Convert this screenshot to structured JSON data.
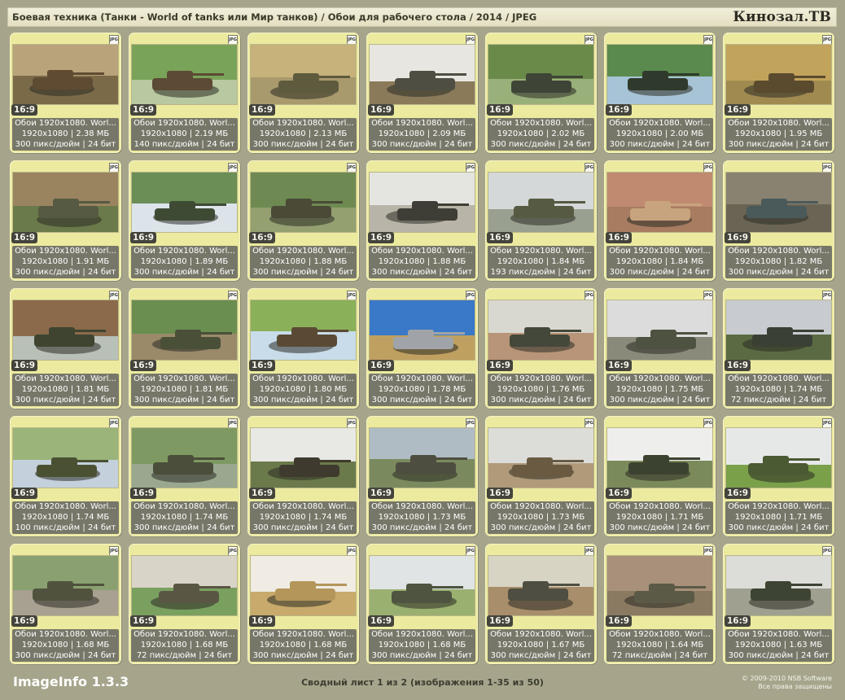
{
  "header": {
    "title": "Боевая техника (Танки - World of tanks или Мир танков) / Обои для рабочего стола / 2014 / JPEG",
    "brand": "Кинозал.ТВ"
  },
  "file_type_icon": "JPG",
  "aspect_label": "16:9",
  "thumbnails": [
    {
      "name": "Обои 1920x1080. Worl...",
      "dims": "1920x1080",
      "size": "2.38 МБ",
      "dpi": "300 пикс/дюйм",
      "bits": "24 бит",
      "colors": [
        "#b9a37a",
        "#5f4a32",
        "#7a6a48"
      ]
    },
    {
      "name": "Обои 1920x1080. Worl...",
      "dims": "1920x1080",
      "size": "2.19 МБ",
      "dpi": "140 пикс/дюйм",
      "bits": "24 бит",
      "colors": [
        "#7aa35a",
        "#5c4a34",
        "#b8c8a0"
      ]
    },
    {
      "name": "Обои 1920x1080. Worl...",
      "dims": "1920x1080",
      "size": "2.13 МБ",
      "dpi": "300 пикс/дюйм",
      "bits": "24 бит",
      "colors": [
        "#c6b27a",
        "#5e5a3e",
        "#a89a6c"
      ]
    },
    {
      "name": "Обои 1920x1080. Worl...",
      "dims": "1920x1080",
      "size": "2.09 МБ",
      "dpi": "300 пикс/дюйм",
      "bits": "24 бит",
      "colors": [
        "#e8e6e0",
        "#4e4e42",
        "#8a7a5a"
      ]
    },
    {
      "name": "Обои 1920x1080. Worl...",
      "dims": "1920x1080",
      "size": "2.02 МБ",
      "dpi": "300 пикс/дюйм",
      "bits": "24 бит",
      "colors": [
        "#6a8a4a",
        "#3e4436",
        "#9ab07a"
      ]
    },
    {
      "name": "Обои 1920x1080. Worl...",
      "dims": "1920x1080",
      "size": "2.00 МБ",
      "dpi": "300 пикс/дюйм",
      "bits": "24 бит",
      "colors": [
        "#5a8a4e",
        "#2f3a2c",
        "#a7c4d6"
      ]
    },
    {
      "name": "Обои 1920x1080. Worl...",
      "dims": "1920x1080",
      "size": "1.95 МБ",
      "dpi": "300 пикс/дюйм",
      "bits": "24 бит",
      "colors": [
        "#c2a35c",
        "#5a4a2e",
        "#a08a50"
      ]
    },
    {
      "name": "Обои 1920x1080. Worl...",
      "dims": "1920x1080",
      "size": "1.91 МБ",
      "dpi": "300 пикс/дюйм",
      "bits": "24 бит",
      "colors": [
        "#9a8460",
        "#565a42",
        "#6a7a4a"
      ]
    },
    {
      "name": "Обои 1920x1080. Worl...",
      "dims": "1920x1080",
      "size": "1.89 МБ",
      "dpi": "300 пикс/дюйм",
      "bits": "24 бит",
      "colors": [
        "#6a8e56",
        "#3e4a34",
        "#dce4ea"
      ]
    },
    {
      "name": "Обои 1920x1080. Worl...",
      "dims": "1920x1080",
      "size": "1.88 МБ",
      "dpi": "300 пикс/дюйм",
      "bits": "24 бит",
      "colors": [
        "#6e8a52",
        "#4a4a36",
        "#94a070"
      ]
    },
    {
      "name": "Обои 1920x1080. Worl...",
      "dims": "1920x1080",
      "size": "1.88 МБ",
      "dpi": "300 пикс/дюйм",
      "bits": "24 бит",
      "colors": [
        "#e4e4e0",
        "#3e3e36",
        "#b8b4a8"
      ]
    },
    {
      "name": "Обои 1920x1080. Worl...",
      "dims": "1920x1080",
      "size": "1.84 МБ",
      "dpi": "193 пикс/дюйм",
      "bits": "24 бит",
      "colors": [
        "#d4d8d8",
        "#565a42",
        "#9aa090"
      ]
    },
    {
      "name": "Обои 1920x1080. Worl...",
      "dims": "1920x1080",
      "size": "1.84 МБ",
      "dpi": "300 пикс/дюйм",
      "bits": "24 бит",
      "colors": [
        "#c08a70",
        "#c8a47e",
        "#a87c60"
      ]
    },
    {
      "name": "Обои 1920x1080. Worl...",
      "dims": "1920x1080",
      "size": "1.82 МБ",
      "dpi": "300 пикс/дюйм",
      "bits": "24 бит",
      "colors": [
        "#8a8270",
        "#4a5a5a",
        "#6a6454"
      ]
    },
    {
      "name": "Обои 1920x1080. Worl...",
      "dims": "1920x1080",
      "size": "1.81 МБ",
      "dpi": "300 пикс/дюйм",
      "bits": "24 бит",
      "colors": [
        "#8a6a4a",
        "#3e4430",
        "#b8c0b8"
      ]
    },
    {
      "name": "Обои 1920x1080. Worl...",
      "dims": "1920x1080",
      "size": "1.81 МБ",
      "dpi": "300 пикс/дюйм",
      "bits": "24 бит",
      "colors": [
        "#6a8e50",
        "#4a5038",
        "#9a8a6a"
      ]
    },
    {
      "name": "Обои 1920x1080. Worl...",
      "dims": "1920x1080",
      "size": "1.80 МБ",
      "dpi": "300 пикс/дюйм",
      "bits": "24 бит",
      "colors": [
        "#8ab05a",
        "#5a4a34",
        "#c8dcea"
      ]
    },
    {
      "name": "Обои 1920x1080. Worl...",
      "dims": "1920x1080",
      "size": "1.78 МБ",
      "dpi": "300 пикс/дюйм",
      "bits": "24 бит",
      "colors": [
        "#3a78c8",
        "#a0a4a8",
        "#c0a060"
      ]
    },
    {
      "name": "Обои 1920x1080. Worl...",
      "dims": "1920x1080",
      "size": "1.76 МБ",
      "dpi": "300 пикс/дюйм",
      "bits": "24 бит",
      "colors": [
        "#d8d8d0",
        "#44483a",
        "#b89478"
      ]
    },
    {
      "name": "Обои 1920x1080. Worl...",
      "dims": "1920x1080",
      "size": "1.75 МБ",
      "dpi": "300 пикс/дюйм",
      "bits": "24 бит",
      "colors": [
        "#dcdcdc",
        "#4e5240",
        "#8a8a7a"
      ]
    },
    {
      "name": "Обои 1920x1080. Worl...",
      "dims": "1920x1080",
      "size": "1.74 МБ",
      "dpi": "72 пикс/дюйм",
      "bits": "24 бит",
      "colors": [
        "#c8ccd0",
        "#3a4034",
        "#5a6a42"
      ]
    },
    {
      "name": "Обои 1920x1080. Worl...",
      "dims": "1920x1080",
      "size": "1.74 МБ",
      "dpi": "100 пикс/дюйм",
      "bits": "24 бит",
      "colors": [
        "#9ab47a",
        "#4a5032",
        "#c4d0dc"
      ]
    },
    {
      "name": "Обои 1920x1080. Worl...",
      "dims": "1920x1080",
      "size": "1.74 МБ",
      "dpi": "300 пикс/дюйм",
      "bits": "24 бит",
      "colors": [
        "#7e9a62",
        "#4a4e3a",
        "#9aa890"
      ]
    },
    {
      "name": "Обои 1920x1080. Worl...",
      "dims": "1920x1080",
      "size": "1.74 МБ",
      "dpi": "300 пикс/дюйм",
      "bits": "24 бит",
      "colors": [
        "#e8e8e4",
        "#3e3a2e",
        "#6a7a4a"
      ]
    },
    {
      "name": "Обои 1920x1080. Worl...",
      "dims": "1920x1080",
      "size": "1.73 МБ",
      "dpi": "300 пикс/дюйм",
      "bits": "24 бит",
      "colors": [
        "#b0bcc4",
        "#4e4e40",
        "#7a8a5e"
      ]
    },
    {
      "name": "Обои 1920x1080. Worl...",
      "dims": "1920x1080",
      "size": "1.73 МБ",
      "dpi": "300 пикс/дюйм",
      "bits": "24 бит",
      "colors": [
        "#dcdcd8",
        "#6a5a42",
        "#b09a7a"
      ]
    },
    {
      "name": "Обои 1920x1080. Worl...",
      "dims": "1920x1080",
      "size": "1.71 МБ",
      "dpi": "300 пикс/дюйм",
      "bits": "24 бит",
      "colors": [
        "#eeeeec",
        "#3c4230",
        "#7a8a5a"
      ]
    },
    {
      "name": "Обои 1920x1080. Worl...",
      "dims": "1920x1080",
      "size": "1.71 МБ",
      "dpi": "300 пикс/дюйм",
      "bits": "24 бит",
      "colors": [
        "#e6e8e8",
        "#4a5a32",
        "#7aa04a"
      ]
    },
    {
      "name": "Обои 1920x1080. Worl...",
      "dims": "1920x1080",
      "size": "1.68 МБ",
      "dpi": "300 пикс/дюйм",
      "bits": "24 бит",
      "colors": [
        "#8aa070",
        "#50523e",
        "#a8a090"
      ]
    },
    {
      "name": "Обои 1920x1080. Worl...",
      "dims": "1920x1080",
      "size": "1.68 МБ",
      "dpi": "72 пикс/дюйм",
      "bits": "24 бит",
      "colors": [
        "#d8d4c8",
        "#5a5644",
        "#7aa060"
      ]
    },
    {
      "name": "Обои 1920x1080. Worl...",
      "dims": "1920x1080",
      "size": "1.68 МБ",
      "dpi": "300 пикс/дюйм",
      "bits": "24 бит",
      "colors": [
        "#f0ece4",
        "#b4965a",
        "#c8aa6c"
      ]
    },
    {
      "name": "Обои 1920x1080. Worl...",
      "dims": "1920x1080",
      "size": "1.68 МБ",
      "dpi": "300 пикс/дюйм",
      "bits": "24 бит",
      "colors": [
        "#e0e4e4",
        "#4e5440",
        "#9ab070"
      ]
    },
    {
      "name": "Обои 1920x1080. Worl...",
      "dims": "1920x1080",
      "size": "1.67 МБ",
      "dpi": "300 пикс/дюйм",
      "bits": "24 бит",
      "colors": [
        "#d8d4c4",
        "#4e4e42",
        "#a88e6a"
      ]
    },
    {
      "name": "Обои 1920x1080. Worl...",
      "dims": "1920x1080",
      "size": "1.64 МБ",
      "dpi": "72 пикс/дюйм",
      "bits": "24 бит",
      "colors": [
        "#a8907a",
        "#5a5a46",
        "#8a7a62"
      ]
    },
    {
      "name": "Обои 1920x1080. Worl...",
      "dims": "1920x1080",
      "size": "1.63 МБ",
      "dpi": "300 пикс/дюйм",
      "bits": "24 бит",
      "colors": [
        "#dcdcd8",
        "#3e4434",
        "#a0a090"
      ]
    }
  ],
  "footer": {
    "app_name": "ImageInfo 1.3.3",
    "page_info": "Сводный лист 1 из 2 (изображения 1-35 из 50)",
    "copyright_line1": "© 2009-2010 NSB Software",
    "copyright_line2": "Все права защищены"
  }
}
